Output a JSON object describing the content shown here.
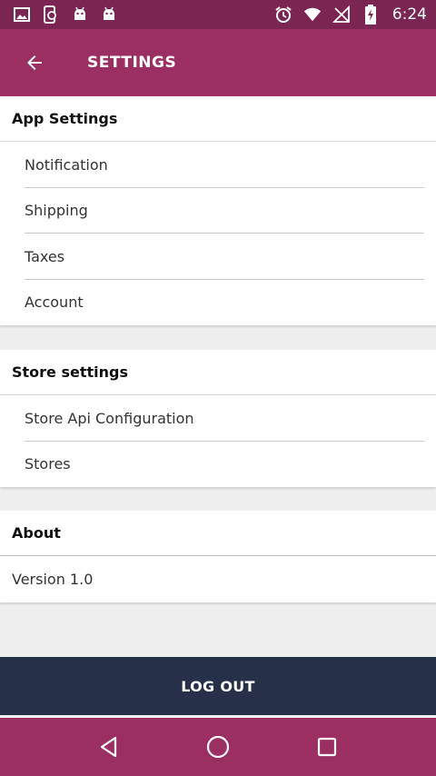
{
  "status_bar": {
    "time": "6:24",
    "left_icons": [
      "image-icon",
      "phone-sync-icon",
      "android-icon",
      "android-icon"
    ],
    "right_icons": [
      "alarm-icon",
      "wifi-icon",
      "no-signal-icon",
      "battery-charging-icon"
    ]
  },
  "app_bar": {
    "title": "SETTINGS",
    "back_icon": "arrow-back-icon"
  },
  "app_settings": {
    "heading": "App Settings",
    "items": [
      "Notification",
      "Shipping",
      "Taxes",
      "Account"
    ]
  },
  "store_settings": {
    "heading": "Store settings",
    "items": [
      "Store Api Configuration",
      "Stores"
    ]
  },
  "about": {
    "heading": "About",
    "version": "Version 1.0"
  },
  "logout_label": "LOG OUT",
  "nav_bar": {
    "icons": [
      "back-triangle-icon",
      "home-circle-icon",
      "recents-square-icon"
    ]
  },
  "colors": {
    "status_bar": "#7a2552",
    "app_bar": "#9c2f62",
    "logout": "#263048",
    "background": "#eeeeee"
  }
}
